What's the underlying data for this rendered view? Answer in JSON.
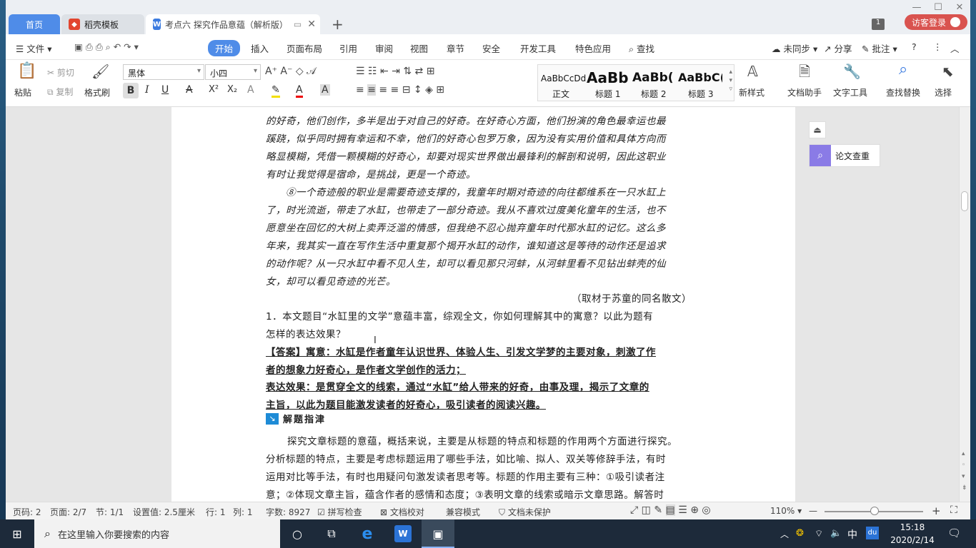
{
  "tabs": {
    "home": "首页",
    "templates": "稻壳模板",
    "document": "考点六 探究作品意蕴（解析版）",
    "new_tab": "+"
  },
  "window": {
    "page_count_badge": "1",
    "login": "访客登录"
  },
  "menu": {
    "file": "文件",
    "items": [
      "开始",
      "插入",
      "页面布局",
      "引用",
      "审阅",
      "视图",
      "章节",
      "安全",
      "开发工具",
      "特色应用"
    ],
    "search": "查找",
    "sync": "未同步",
    "share": "分享",
    "comment": "批注",
    "help": "?"
  },
  "ribbon": {
    "paste": "粘贴",
    "cut": "剪切",
    "copy": "复制",
    "format_painter": "格式刷",
    "font_name": "黑体",
    "font_size": "小四",
    "bold": "B",
    "italic": "I",
    "underline": "U",
    "strike": "A",
    "superscript": "X²",
    "subscript": "X₂",
    "styles": [
      {
        "preview": "AaBbCcDd",
        "label": "正文"
      },
      {
        "preview": "AaBb",
        "label": "标题 1"
      },
      {
        "preview": "AaBb(",
        "label": "标题 2"
      },
      {
        "preview": "AaBbC(",
        "label": "标题 3"
      }
    ],
    "new_style": "新样式",
    "doc_helper": "文档助手",
    "text_tools": "文字工具",
    "find_replace": "查找替换",
    "select": "选择"
  },
  "side_panel": {
    "paper_check": "论文查重"
  },
  "document": {
    "lines": [
      "的好奇，他们创作，多半是出于对自己的好奇。在好奇心方面，他们扮演的角色最幸运也最",
      "蹊跷，似乎同时拥有幸运和不幸，他们的好奇心包罗万象，因为没有实用价值和具体方向而",
      "略显模糊，凭借一颗模糊的好奇心，却要对现实世界做出最锋利的解剖和说明，因此这职业",
      "有时让我觉得是宿命，是挑战，更是一个奇迹。",
      "⑧一个奇迹般的职业是需要奇迹支撑的，我童年时期对奇迹的向往都维系在一只水缸上",
      "了，时光流逝，带走了水缸，也带走了一部分奇迹。我从不喜欢过度美化童年的生活，也不",
      "愿意坐在回忆的大树上卖弄泛滥的情感，但我绝不忍心抛弃童年时代那水缸的记忆。这么多",
      "年来，我其实一直在写作生活中重复那个揭开水缸的动作，谁知道这是等待的动作还是追求",
      "的动作呢？从一只水缸中看不见人生，却可以看见那只河蚌，从河蚌里看不见钻出蚌壳的仙",
      "女，却可以看见奇迹的光芒。"
    ],
    "source": "（取材于苏童的同名散文）",
    "question": [
      "1．本文题目“水缸里的文学”意蕴丰富，综观全文，你如何理解其中的寓意？以此为题有",
      "怎样的表达效果？"
    ],
    "answer": [
      "【答案】寓意：水缸是作者童年认识世界、体验人生、引发文学梦的主要对象，刺激了作",
      "者的想象力好奇心，是作者文学创作的活力；",
      "表达效果：是贯穿全文的线索，通过“水缸”给人带来的好奇，由事及理，揭示了文章的",
      "主旨，以此为题目能激发读者的好奇心，吸引读者的阅读兴趣。"
    ],
    "guide_title": "解题指津",
    "guide": [
      "探究文章标题的意蕴，概括来说，主要是从标题的特点和标题的作用两个方面进行探究。",
      "分析标题的特点，主要是考虑标题运用了哪些手法，如比喻、拟人、双关等修辞手法，有时",
      "运用对比等手法，有时也用疑问句激发读者思考等。标题的作用主要有三种：①吸引读者注",
      "意；②体现文章主旨，蕴含作者的感情和态度；③表明文章的线索或暗示文章思路。解答时"
    ]
  },
  "status": {
    "page_no": "页码: 2",
    "pages": "页面: 2/7",
    "section": "节: 1/1",
    "setting": "设置值: 2.5厘米",
    "row": "行: 1",
    "col": "列: 1",
    "words": "字数: 8927",
    "spell": "拼写检查",
    "proof": "文档校对",
    "compat": "兼容模式",
    "protect": "文档未保护",
    "zoom": "110%"
  },
  "taskbar": {
    "search_placeholder": "在这里输入你要搜索的内容",
    "ime": "中",
    "baidu": "du",
    "time": "15:18",
    "date": "2020/2/14"
  },
  "colors": {
    "accent": "#4f8ce8",
    "login_btn": "#d9534f",
    "wps_red": "#e2452f",
    "taskbar": "#1d2a3a"
  }
}
